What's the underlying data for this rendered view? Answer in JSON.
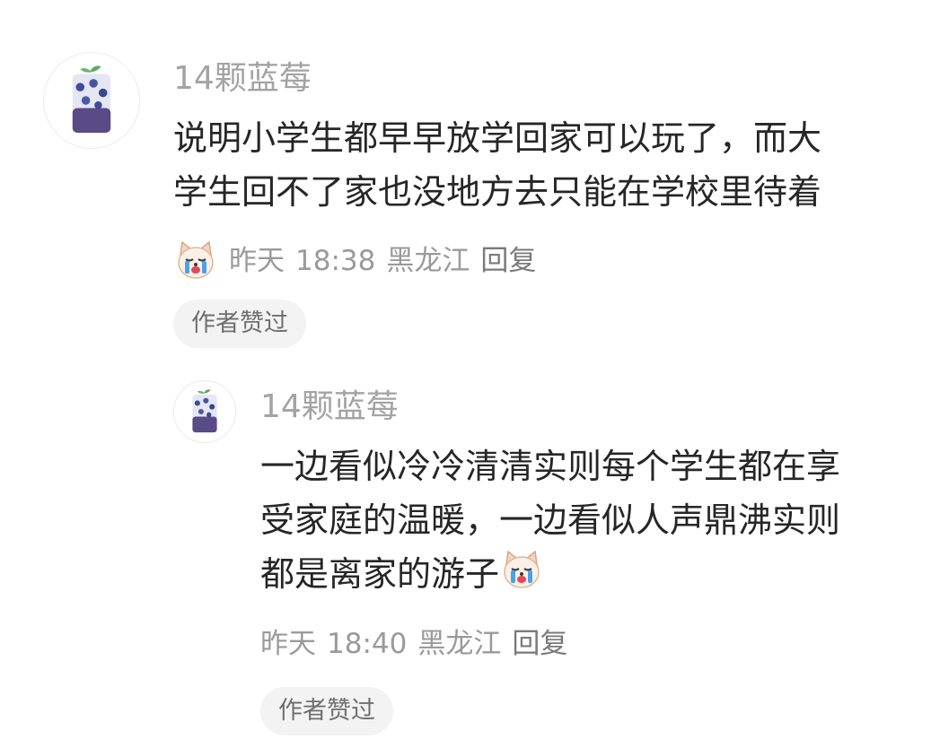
{
  "comments": [
    {
      "username": "14颗蓝莓",
      "lines": [
        "说明小学生都早早放学回家可以玩了，而大",
        "学生回不了家也没地方去只能在学校里待着"
      ],
      "emoji": "crying-dog-emoji",
      "date": "昨天",
      "time": "18:38",
      "location": "黑龙江",
      "reply_label": "回复",
      "liked_badge": "作者赞过"
    },
    {
      "username": "14颗蓝莓",
      "lines": [
        "一边看似冷冷清清实则每个学生都在享",
        "受家庭的温暖，一边看似人声鼎沸实则",
        "都是离家的游子"
      ],
      "emoji": "crying-dog-emoji",
      "date": "昨天",
      "time": "18:40",
      "location": "黑龙江",
      "reply_label": "回复",
      "liked_badge": "作者赞过"
    }
  ],
  "icons": {
    "avatar": "blueberry-drink-avatar",
    "emoji": "crying-dog-emoji"
  },
  "colors": {
    "username": "#a3a3a3",
    "content": "#262626",
    "meta": "#9a9a9a",
    "badge_bg": "#f3f3f3"
  }
}
